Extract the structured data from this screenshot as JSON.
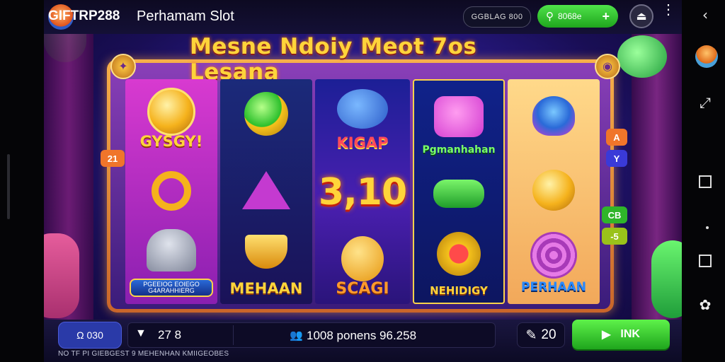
{
  "header": {
    "brand": "GIFTRP288",
    "title": "Perhamam Slot",
    "balance_pill": "GGBLAG 800",
    "deposit_pill": {
      "icon": "search-icon",
      "label": "8068e",
      "plus": "+"
    },
    "menu_dots": "⋮"
  },
  "banner": {
    "text": "Mesne Ndoiy Meot 7os Lesana"
  },
  "reels": {
    "col1": {
      "top_label": "GYSGY!",
      "plate_text": "PGEEIOG EOIEGO G4ARAHHIERG"
    },
    "col2": {
      "bottom_label": "MEHAAN"
    },
    "col3": {
      "top_label": "KIGAP",
      "big_number": "3,10",
      "bottom_label": "SCAGI"
    },
    "col4": {
      "top_label": "Pgmanhahan",
      "bottom_label": "NEHIDIGY"
    },
    "col5": {
      "bottom_label": "PERHAAN"
    }
  },
  "side_chips": {
    "left": "21",
    "right_a": "A",
    "right_y": "Y",
    "right_green1": "CB",
    "right_green2": "-5"
  },
  "bottom": {
    "wallet": "Ω 030",
    "bet_icon": "▼",
    "bet_value": "27 8",
    "players_icon": "people-icon",
    "players_text": "1008 ponens 96.258",
    "lines_value": "20",
    "spin_label": "INK",
    "footer_text": "NO TF PI GIEBGEST 9 MEHENHAN KMIIGEOBES"
  },
  "colors": {
    "accent_gold": "#ffd43a",
    "spin_green": "#2fb52a",
    "bg_indigo": "#2a1b8e"
  }
}
